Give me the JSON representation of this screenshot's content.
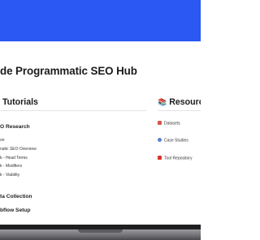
{
  "page": {
    "title": "de Programmatic SEO Hub"
  },
  "left_column": {
    "heading_emoji": "",
    "heading": "Tutorials",
    "sections": [
      {
        "title": "O Research",
        "items": [
          "on",
          "natic SEO Overview",
          "k - Head Terms",
          "k - Modifiers",
          "k - Viability"
        ]
      },
      {
        "title": "ta Collection",
        "items": []
      },
      {
        "title": "bflow Setup",
        "items": []
      }
    ]
  },
  "right_column": {
    "heading_emoji": "📚",
    "heading": "Resources",
    "items": [
      {
        "label": "Datasets",
        "icon": "chart-icon",
        "color": "#d9534f"
      },
      {
        "label": "Case Studies",
        "icon": "magnifier-icon",
        "color": "#5a7fd6"
      },
      {
        "label": "Tool Repository",
        "icon": "toolbox-icon",
        "color": "#d9342b"
      }
    ]
  },
  "colors": {
    "banner": "#2b57f2",
    "laptop_body": "#1f1f22"
  }
}
